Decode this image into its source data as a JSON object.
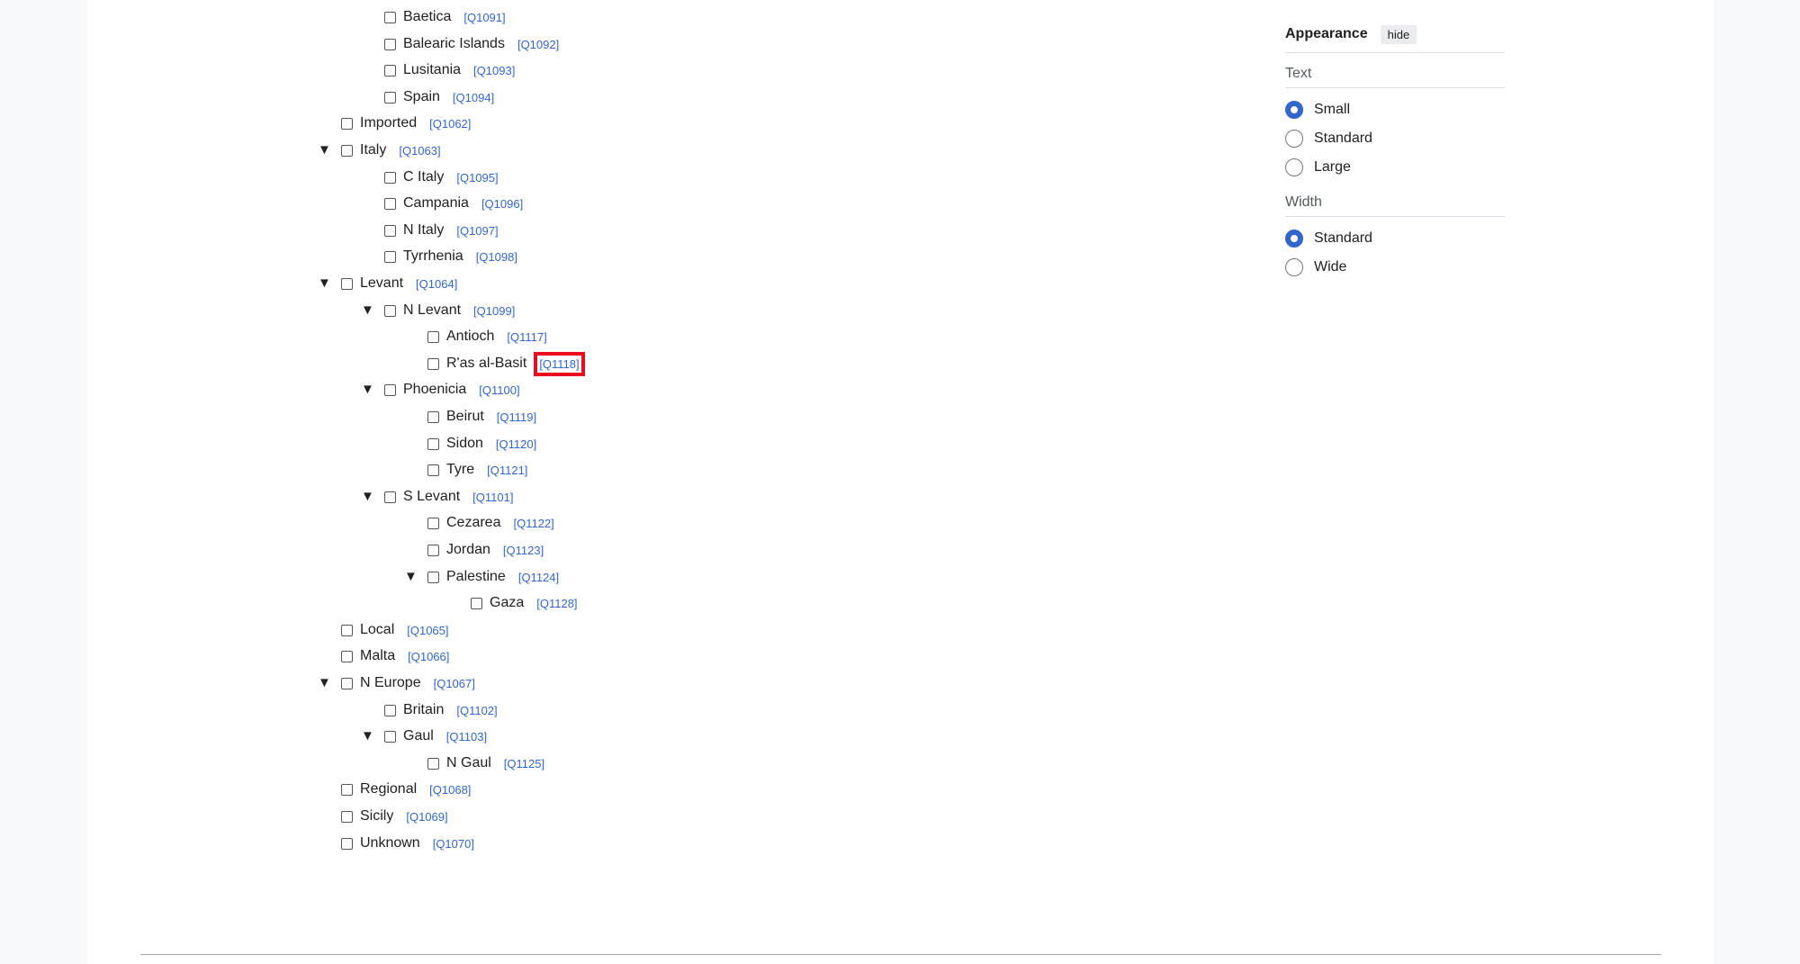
{
  "tree": [
    {
      "label": "Baetica",
      "qid": "[Q1091]",
      "level": 1,
      "expanded": null
    },
    {
      "label": "Balearic Islands",
      "qid": "[Q1092]",
      "level": 1,
      "expanded": null
    },
    {
      "label": "Lusitania",
      "qid": "[Q1093]",
      "level": 1,
      "expanded": null
    },
    {
      "label": "Spain",
      "qid": "[Q1094]",
      "level": 1,
      "expanded": null
    },
    {
      "label": "Imported",
      "qid": "[Q1062]",
      "level": 0,
      "expanded": null
    },
    {
      "label": "Italy",
      "qid": "[Q1063]",
      "level": 0,
      "expanded": true
    },
    {
      "label": "C Italy",
      "qid": "[Q1095]",
      "level": 1,
      "expanded": null
    },
    {
      "label": "Campania",
      "qid": "[Q1096]",
      "level": 1,
      "expanded": null
    },
    {
      "label": "N Italy",
      "qid": "[Q1097]",
      "level": 1,
      "expanded": null
    },
    {
      "label": "Tyrrhenia",
      "qid": "[Q1098]",
      "level": 1,
      "expanded": null
    },
    {
      "label": "Levant",
      "qid": "[Q1064]",
      "level": 0,
      "expanded": true
    },
    {
      "label": "N Levant",
      "qid": "[Q1099]",
      "level": 1,
      "expanded": true
    },
    {
      "label": "Antioch",
      "qid": "[Q1117]",
      "level": 2,
      "expanded": null
    },
    {
      "label": "R'as al-Basit",
      "qid": "[Q1118]",
      "level": 2,
      "expanded": null,
      "highlighted": true
    },
    {
      "label": "Phoenicia",
      "qid": "[Q1100]",
      "level": 1,
      "expanded": true
    },
    {
      "label": "Beirut",
      "qid": "[Q1119]",
      "level": 2,
      "expanded": null
    },
    {
      "label": "Sidon",
      "qid": "[Q1120]",
      "level": 2,
      "expanded": null
    },
    {
      "label": "Tyre",
      "qid": "[Q1121]",
      "level": 2,
      "expanded": null
    },
    {
      "label": "S Levant",
      "qid": "[Q1101]",
      "level": 1,
      "expanded": true
    },
    {
      "label": "Cezarea",
      "qid": "[Q1122]",
      "level": 2,
      "expanded": null
    },
    {
      "label": "Jordan",
      "qid": "[Q1123]",
      "level": 2,
      "expanded": null
    },
    {
      "label": "Palestine",
      "qid": "[Q1124]",
      "level": 2,
      "expanded": true
    },
    {
      "label": "Gaza",
      "qid": "[Q1128]",
      "level": 3,
      "expanded": null
    },
    {
      "label": "Local",
      "qid": "[Q1065]",
      "level": 0,
      "expanded": null
    },
    {
      "label": "Malta",
      "qid": "[Q1066]",
      "level": 0,
      "expanded": null
    },
    {
      "label": "N Europe",
      "qid": "[Q1067]",
      "level": 0,
      "expanded": true
    },
    {
      "label": "Britain",
      "qid": "[Q1102]",
      "level": 1,
      "expanded": null
    },
    {
      "label": "Gaul",
      "qid": "[Q1103]",
      "level": 1,
      "expanded": true
    },
    {
      "label": "N Gaul",
      "qid": "[Q1125]",
      "level": 2,
      "expanded": null
    },
    {
      "label": "Regional",
      "qid": "[Q1068]",
      "level": 0,
      "expanded": null
    },
    {
      "label": "Sicily",
      "qid": "[Q1069]",
      "level": 0,
      "expanded": null
    },
    {
      "label": "Unknown",
      "qid": "[Q1070]",
      "level": 0,
      "expanded": null
    }
  ],
  "expand_glyph": "▼",
  "appearance": {
    "title": "Appearance",
    "hide_label": "hide",
    "text_section": "Text",
    "text_options": [
      "Small",
      "Standard",
      "Large"
    ],
    "text_selected": "Small",
    "width_section": "Width",
    "width_options": [
      "Standard",
      "Wide"
    ],
    "width_selected": "Standard"
  },
  "colors": {
    "link": "#3366cc",
    "highlight": "#ee0a1e",
    "radio_on": "#3366cc"
  }
}
